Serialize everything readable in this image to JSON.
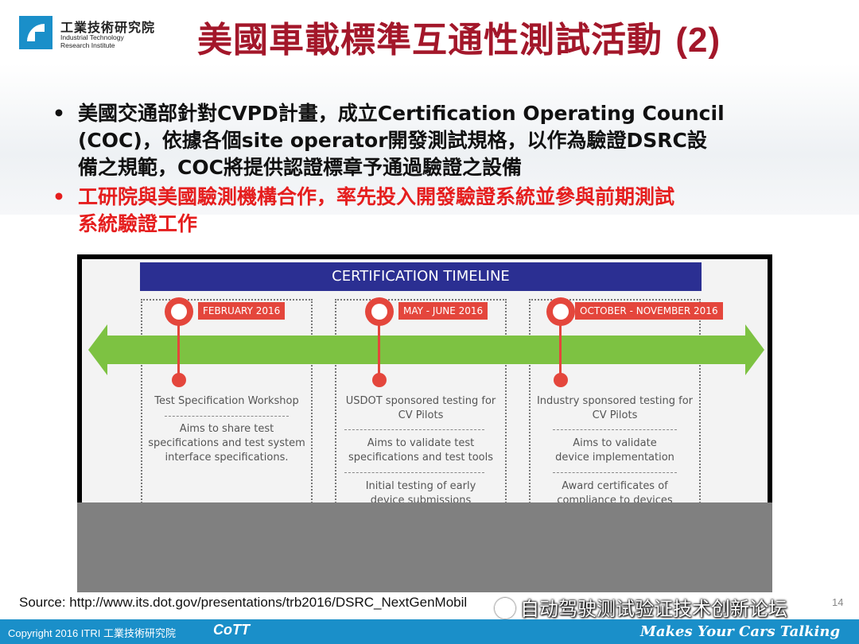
{
  "header": {
    "org_cn": "工業技術研究院",
    "org_en_line1": "Industrial Technology",
    "org_en_line2": "Research Institute",
    "title": "美國車載標準互通性測試活動",
    "title_suffix": "(2)"
  },
  "bullets": [
    {
      "line1": "美國交通部針對CVPD計畫，成立Certification Operating Council",
      "line2": "(COC)，依據各個site operator開發測試規格，以作為驗證DSRC設",
      "line3": "備之規範，COC將提供認證標章予通過驗證之設備",
      "color": "#111111"
    },
    {
      "line1": "工研院與美國驗測機構合作，率先投入開發驗證系統並參與前期測試",
      "line2": "系統驗證工作",
      "color": "#e51e1e"
    }
  ],
  "bullet_symbol": "•",
  "timeline": {
    "title": "CERTIFICATION TIMELINE",
    "columns": [
      {
        "date": "FEBRUARY 2016",
        "heading_1": "Test Specification Workshop",
        "heading_2": "",
        "body_1": "Aims to share test",
        "body_2": "specifications and test system",
        "body_3": "interface specifications.",
        "extra_1": "",
        "extra_2": ""
      },
      {
        "date": "MAY - JUNE 2016",
        "heading_1": "USDOT sponsored testing for",
        "heading_2": "CV Pilots",
        "body_1": "Aims to validate test",
        "body_2": "specifications and test tools",
        "body_3": "",
        "extra_1": "Initial testing of early",
        "extra_2": "device submissions"
      },
      {
        "date": "OCTOBER - NOVEMBER 2016",
        "heading_1": "Industry sponsored testing for",
        "heading_2": "CV Pilots",
        "body_1": "Aims to validate",
        "body_2": "device implementation",
        "body_3": "",
        "extra_1": "Award certificates of",
        "extra_2": "compliance to devices"
      }
    ]
  },
  "colors": {
    "title": "#a3172a",
    "brand_blue": "#1a8fc9",
    "timeline_header": "#2b2f92",
    "arrow_green": "#7dc242",
    "pin_red": "#e4463c"
  },
  "source": "Source: http://www.its.dot.gov/presentations/trb2016/DSRC_NextGenMobil",
  "watermark": "自动驾驶测试验证技术创新论坛",
  "footer": {
    "copyright": "Copyright 2016 ITRI 工業技術研究院",
    "cott": "CoTT",
    "tagline": "Makes Your Cars Talking",
    "page_number": "14"
  }
}
